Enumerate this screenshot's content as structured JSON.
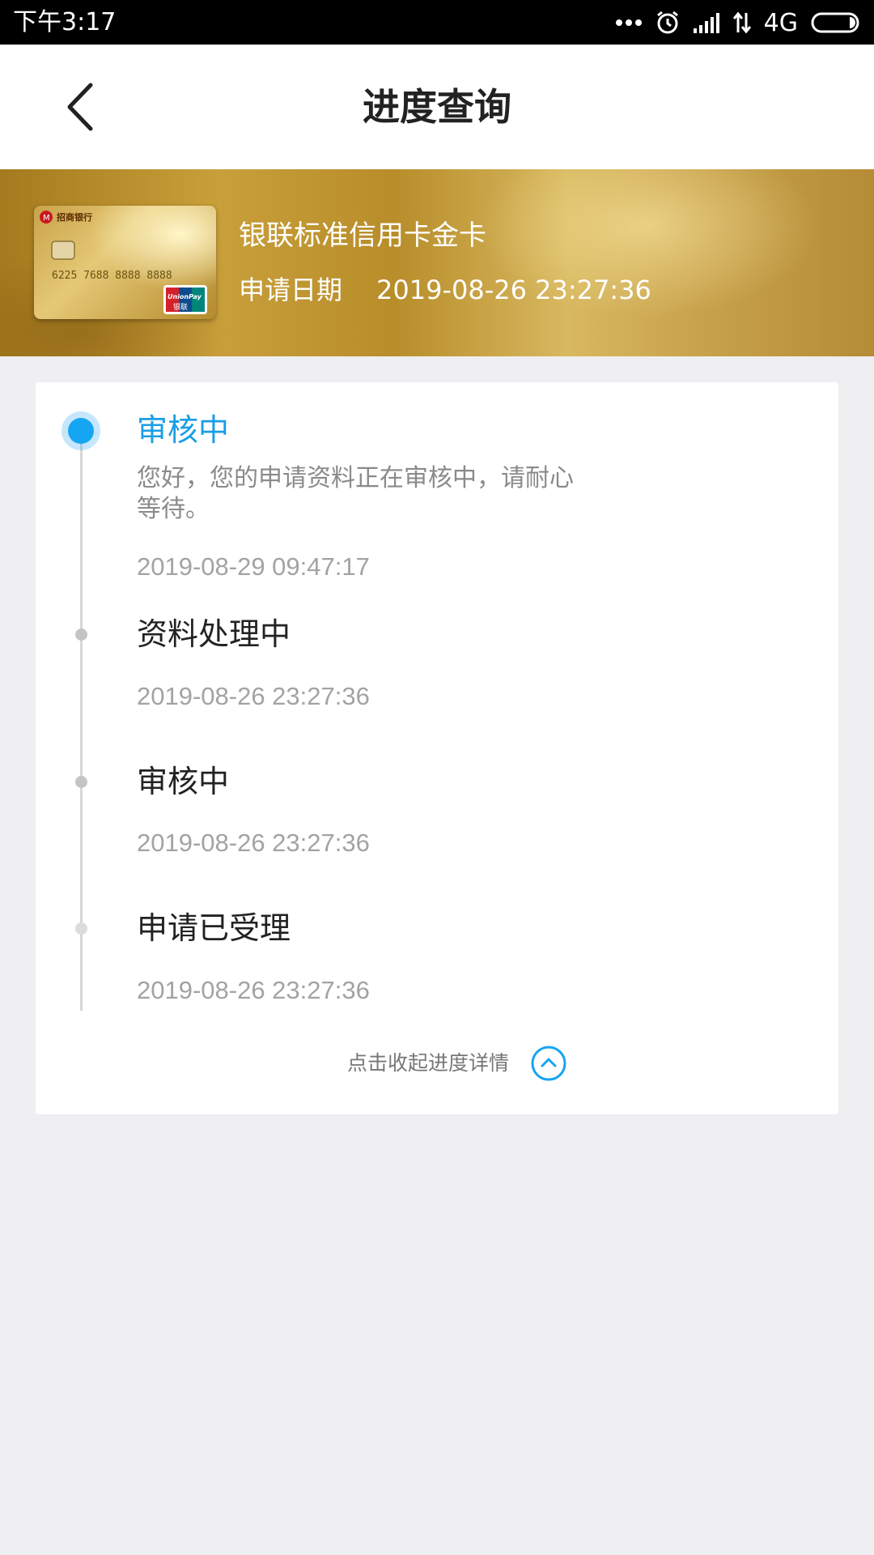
{
  "status_bar": {
    "time": "下午3:17",
    "network": "4G",
    "icons": [
      "more-dots-icon",
      "alarm-icon",
      "signal-icon",
      "data-transfer-icon",
      "battery-icon"
    ]
  },
  "nav": {
    "title": "进度查询",
    "back_icon": "back-chevron-icon"
  },
  "card": {
    "name": "银联标准信用卡金卡",
    "apply_label": "申请日期",
    "apply_date": "2019-08-26 23:27:36",
    "image": {
      "bank_name": "招商银行",
      "number": "6225 7688 8888 8888",
      "brand": "UnionPay",
      "brand_cn": "银联"
    }
  },
  "timeline": {
    "steps": [
      {
        "title": "审核中",
        "description": "您好，您的申请资料正在审核中，请耐心等待。",
        "time": "2019-08-29 09:47:17",
        "active": true
      },
      {
        "title": "资料处理中",
        "time": "2019-08-26 23:27:36",
        "active": false
      },
      {
        "title": "审核中",
        "time": "2019-08-26 23:27:36",
        "active": false
      },
      {
        "title": "申请已受理",
        "time": "2019-08-26 23:27:36",
        "active": false
      }
    ],
    "collapse_label": "点击收起进度详情"
  },
  "colors": {
    "accent": "#16a5f2",
    "title_text": "#222222",
    "muted_text": "#a3a3a3",
    "background": "#efeff1"
  }
}
